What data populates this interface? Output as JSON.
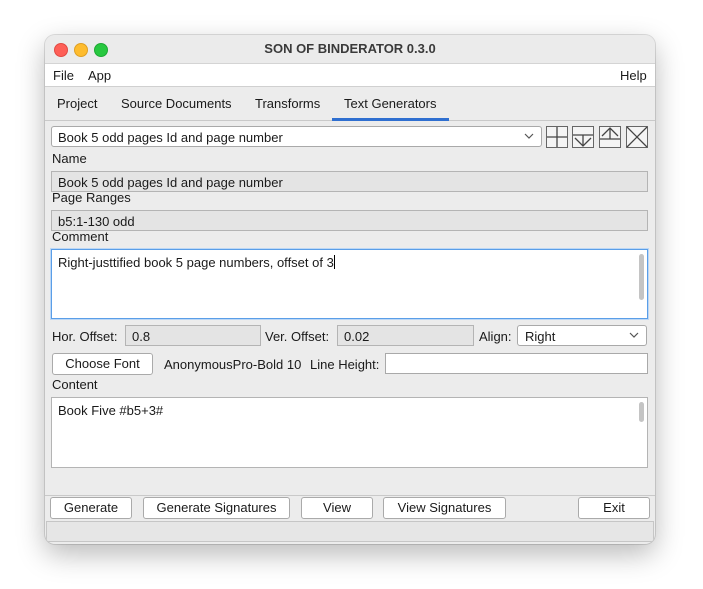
{
  "window": {
    "title": "SON OF BINDERATOR 0.3.0"
  },
  "menu": {
    "file": "File",
    "app": "App",
    "help": "Help"
  },
  "tabs": [
    {
      "label": "Project"
    },
    {
      "label": "Source Documents"
    },
    {
      "label": "Transforms"
    },
    {
      "label": "Text Generators",
      "active": true
    }
  ],
  "generator": {
    "selected": "Book 5 odd pages Id and page number",
    "name_label": "Name",
    "name_value": "Book 5 odd pages Id and page number",
    "page_ranges_label": "Page Ranges",
    "page_ranges_value": "b5:1-130 odd",
    "comment_label": "Comment",
    "comment_value": "Right-justtified book 5 page numbers, offset of 3",
    "hor_offset_label": "Hor. Offset:",
    "hor_offset_value": "0.8",
    "ver_offset_label": "Ver. Offset:",
    "ver_offset_value": "0.02",
    "align_label": "Align:",
    "align_value": "Right",
    "choose_font_label": "Choose Font",
    "font_value": "AnonymousPro-Bold 10",
    "line_height_label": "Line Height:",
    "line_height_value": "",
    "content_label": "Content",
    "content_value": "Book Five #b5+3#"
  },
  "icons": {
    "add": "plus-icon",
    "move_down": "arrow-down-icon",
    "move_up": "arrow-up-icon",
    "delete": "x-icon",
    "dropdown": "chevron-down-icon"
  },
  "actions": {
    "generate": "Generate",
    "generate_signatures": "Generate Signatures",
    "view": "View",
    "view_signatures": "View Signatures",
    "exit": "Exit"
  },
  "colors": {
    "accent": "#2f6fd0",
    "focus": "#5a9ee8"
  }
}
